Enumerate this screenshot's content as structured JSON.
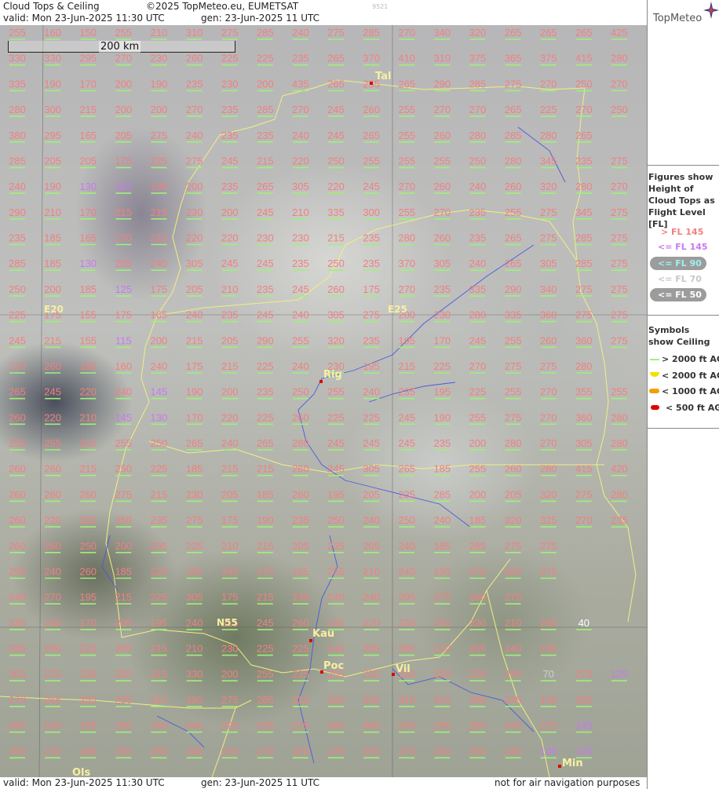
{
  "header": {
    "title": "Cloud Tops & Ceiling",
    "copyright": "©2025 TopMeteo.eu, EUMETSAT",
    "code": "9521",
    "valid": "valid:  Mon  23-Jun-2025  11:30 UTC",
    "gen": "gen: 23-Jun-2025 11 UTC"
  },
  "logo": {
    "text": "TopMeteo",
    "icon": "compass-star-icon"
  },
  "footer": {
    "valid": "valid:  Mon  23-Jun-2025  11:30 UTC",
    "gen": "gen: 23-Jun-2025 11 UTC",
    "note": "not for air navigation purposes"
  },
  "scale_bar": "200 km",
  "legend": {
    "title": "Figures show Height of Cloud Tops as Flight Level  [FL]",
    "items": [
      {
        "label": "> FL 145",
        "color": "#f08080"
      },
      {
        "label": "<= FL 145",
        "color": "#c878f0"
      },
      {
        "label": "<= FL 90",
        "color": "#9ff0f0",
        "pill": true
      },
      {
        "label": "<= FL 70",
        "color": "#c8c8c8"
      },
      {
        "label": "<= FL 50",
        "color": "#ffffff",
        "pill": true
      }
    ],
    "symbols_title": "Symbols show Ceiling",
    "symbols": [
      {
        "label": "> 2000 ft AGL",
        "color": "#9ef07a",
        "shape": "line"
      },
      {
        "label": "< 2000 ft AGL",
        "color": "#f0e000",
        "shape": "half-circle"
      },
      {
        "label": "< 1000 ft AGL",
        "color": "#f0a000",
        "shape": "bar"
      },
      {
        "label": "< 500 ft AGL",
        "color": "#e00000",
        "shape": "bar"
      }
    ]
  },
  "map": {
    "cities": [
      "Tal",
      "Rig",
      "Kau",
      "Poc",
      "Vil",
      "Min",
      "Ols"
    ],
    "grid_labels": [
      "E20",
      "E25",
      "N55"
    ],
    "colors": {
      "high": "#f08080",
      "mid": "#c878f0",
      "low90": "#9ff0f0",
      "low70": "#d0d0d0",
      "low50": "#ffffff"
    },
    "rows": [
      [
        "255",
        "160",
        "150",
        "255",
        "210",
        "310",
        "275",
        "285",
        "240",
        "275",
        "285",
        "270",
        "340",
        "320",
        "265",
        "265",
        "265",
        "425"
      ],
      [
        "330",
        "330",
        "295",
        "270",
        "230",
        "260",
        "225",
        "225",
        "235",
        "265",
        "370",
        "410",
        "310",
        "375",
        "365",
        "375",
        "415",
        "280",
        "225"
      ],
      [
        "335",
        "190",
        "170",
        "200",
        "190",
        "235",
        "230",
        "200",
        "435",
        "265",
        "255",
        "265",
        "290",
        "285",
        "275",
        "270",
        "250",
        "270"
      ],
      [
        "280",
        "300",
        "215",
        "200",
        "200",
        "270",
        "235",
        "285",
        "270",
        "245",
        "260",
        "255",
        "270",
        "270",
        "265",
        "225",
        "270",
        "250"
      ],
      [
        "380",
        "295",
        "165",
        "205",
        "275",
        "240",
        "235",
        "235",
        "240",
        "245",
        "265",
        "255",
        "260",
        "280",
        "285",
        "280",
        "265"
      ],
      [
        "285",
        "205",
        "205",
        "175",
        "225",
        "275",
        "245",
        "215",
        "220",
        "250",
        "255",
        "255",
        "255",
        "250",
        "280",
        "345",
        "235",
        "275"
      ],
      [
        "240",
        "190",
        "130",
        "115",
        "195",
        "200",
        "235",
        "265",
        "305",
        "220",
        "245",
        "270",
        "260",
        "240",
        "260",
        "320",
        "280",
        "270"
      ],
      [
        "290",
        "210",
        "170",
        "215",
        "215",
        "230",
        "200",
        "245",
        "210",
        "335",
        "300",
        "255",
        "270",
        "235",
        "255",
        "275",
        "345",
        "275",
        "275"
      ],
      [
        "235",
        "185",
        "165",
        "170",
        "225",
        "220",
        "220",
        "230",
        "230",
        "215",
        "235",
        "280",
        "260",
        "235",
        "265",
        "275",
        "285",
        "275"
      ],
      [
        "285",
        "185",
        "130",
        "205",
        "240",
        "305",
        "245",
        "245",
        "235",
        "250",
        "235",
        "370",
        "305",
        "240",
        "265",
        "305",
        "285",
        "275"
      ],
      [
        "250",
        "200",
        "185",
        "125",
        "175",
        "205",
        "210",
        "235",
        "245",
        "260",
        "175",
        "270",
        "235",
        "335",
        "290",
        "340",
        "275",
        "275"
      ],
      [
        "225",
        "175",
        "155",
        "175",
        "165",
        "240",
        "235",
        "245",
        "240",
        "305",
        "275",
        "200",
        "230",
        "280",
        "335",
        "360",
        "275",
        "275"
      ],
      [
        "245",
        "215",
        "155",
        "115",
        "200",
        "215",
        "205",
        "290",
        "255",
        "320",
        "235",
        "195",
        "170",
        "245",
        "255",
        "260",
        "360",
        "275"
      ],
      [
        "270",
        "260",
        "180",
        "160",
        "240",
        "175",
        "215",
        "225",
        "240",
        "230",
        "195",
        "215",
        "225",
        "270",
        "275",
        "275",
        "280"
      ],
      [
        "265",
        "245",
        "220",
        "240",
        "145",
        "190",
        "200",
        "235",
        "250",
        "255",
        "240",
        "235",
        "195",
        "225",
        "255",
        "270",
        "355",
        "255"
      ],
      [
        "260",
        "220",
        "210",
        "145",
        "130",
        "170",
        "220",
        "225",
        "260",
        "225",
        "225",
        "245",
        "190",
        "255",
        "275",
        "270",
        "360",
        "280"
      ],
      [
        "255",
        "255",
        "210",
        "255",
        "250",
        "265",
        "240",
        "265",
        "280",
        "245",
        "245",
        "245",
        "235",
        "200",
        "280",
        "270",
        "305",
        "280"
      ],
      [
        "260",
        "260",
        "215",
        "250",
        "225",
        "185",
        "215",
        "215",
        "260",
        "245",
        "305",
        "265",
        "185",
        "255",
        "260",
        "280",
        "415",
        "420"
      ],
      [
        "260",
        "260",
        "260",
        "275",
        "215",
        "230",
        "205",
        "185",
        "260",
        "195",
        "205",
        "235",
        "285",
        "200",
        "205",
        "320",
        "275",
        "280"
      ],
      [
        "260",
        "220",
        "260",
        "250",
        "235",
        "275",
        "175",
        "190",
        "235",
        "250",
        "240",
        "250",
        "240",
        "185",
        "320",
        "325",
        "270",
        "235",
        "290"
      ],
      [
        "260",
        "260",
        "250",
        "200",
        "205",
        "225",
        "210",
        "215",
        "205",
        "235",
        "205",
        "240",
        "185",
        "285",
        "275",
        "275"
      ],
      [
        "255",
        "240",
        "260",
        "185",
        "225",
        "205",
        "165",
        "175",
        "195",
        "255",
        "210",
        "240",
        "190",
        "270",
        "260",
        "275"
      ],
      [
        "240",
        "270",
        "195",
        "215",
        "225",
        "305",
        "175",
        "215",
        "235",
        "240",
        "240",
        "205",
        "275",
        "260",
        "275"
      ],
      [
        "335",
        "240",
        "170",
        "205",
        "195",
        "240",
        "215",
        "245",
        "260",
        "245",
        "220",
        "230",
        "250",
        "230",
        "210",
        "260",
        "40"
      ],
      [
        "285",
        "260",
        "225",
        "200",
        "215",
        "210",
        "230",
        "225",
        "225",
        "240",
        "205",
        "285",
        "210",
        "255",
        "240",
        "235"
      ],
      [
        "305",
        "270",
        "230",
        "220",
        "215",
        "330",
        "200",
        "255",
        "235",
        "255",
        "250",
        "250",
        "250",
        "225",
        "245",
        "70",
        "270",
        "125"
      ],
      [
        "270",
        "265",
        "255",
        "235",
        "210",
        "320",
        "275",
        "285",
        "220",
        "250",
        "250",
        "310",
        "310",
        "240",
        "245",
        "190",
        "200"
      ],
      [
        "260",
        "240",
        "195",
        "150",
        "240",
        "245",
        "225",
        "325",
        "275",
        "320",
        "300",
        "245",
        "245",
        "260",
        "245",
        "215",
        "145"
      ],
      [
        "250",
        "210",
        "180",
        "250",
        "255",
        "240",
        "220",
        "270",
        "320",
        "270",
        "255",
        "270",
        "240",
        "250",
        "240",
        "105",
        "130"
      ]
    ]
  }
}
